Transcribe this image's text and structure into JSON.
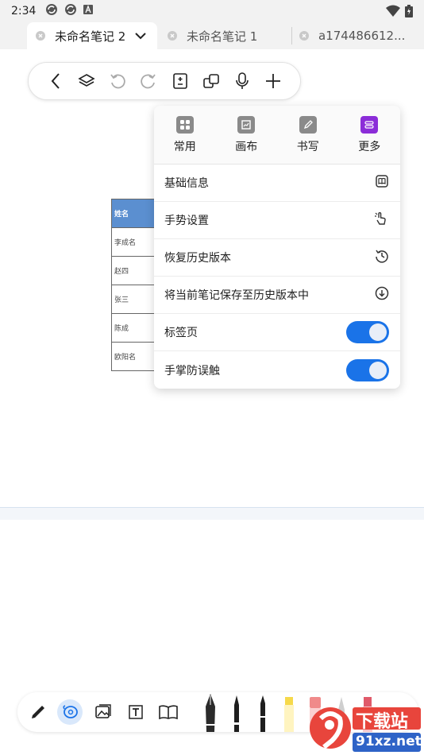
{
  "status_bar": {
    "time": "2:34",
    "icons": [
      "sync-icon",
      "sync-icon",
      "font-icon",
      "wifi-icon",
      "battery-icon"
    ]
  },
  "tabs": [
    {
      "label": "未命名笔记 2",
      "active": true
    },
    {
      "label": "未命名笔记 1",
      "active": false
    },
    {
      "label": "a174486612...",
      "active": false
    }
  ],
  "toolbar": {
    "buttons": [
      "back-icon",
      "layers-icon",
      "undo-icon",
      "redo-icon",
      "page-icon",
      "copy-icon",
      "mic-icon",
      "add-icon"
    ]
  },
  "canvas_table": {
    "header": "姓名",
    "rows": [
      "李成名",
      "赵四",
      "张三",
      "陈成",
      "欧阳名"
    ]
  },
  "menu": {
    "categories": [
      {
        "label": "常用",
        "icon": "grid-icon"
      },
      {
        "label": "画布",
        "icon": "canvas-icon"
      },
      {
        "label": "书写",
        "icon": "pen-icon"
      },
      {
        "label": "更多",
        "icon": "more-icon",
        "active": true
      }
    ],
    "items": [
      {
        "label": "基础信息",
        "icon": "book-icon"
      },
      {
        "label": "手势设置",
        "icon": "gesture-icon"
      },
      {
        "label": "恢复历史版本",
        "icon": "history-icon"
      },
      {
        "label": "将当前笔记保存至历史版本中",
        "icon": "save-down-icon"
      },
      {
        "label": "标签页",
        "toggle": true
      },
      {
        "label": "手掌防误触",
        "toggle": true
      }
    ],
    "accent": "#1a73e8",
    "active_category_color": "#8b2dd8"
  },
  "dock": {
    "tools": [
      "pencil-icon",
      "lasso-icon",
      "image-icon",
      "text-box-icon",
      "book-open-icon"
    ],
    "pens": [
      "fountain-pen",
      "ballpoint-pen",
      "marker-pen",
      "highlighter-pen",
      "eraser",
      "brush",
      "add-pen"
    ]
  },
  "watermark": {
    "line1": "下载站",
    "line2": "91xz.net"
  }
}
